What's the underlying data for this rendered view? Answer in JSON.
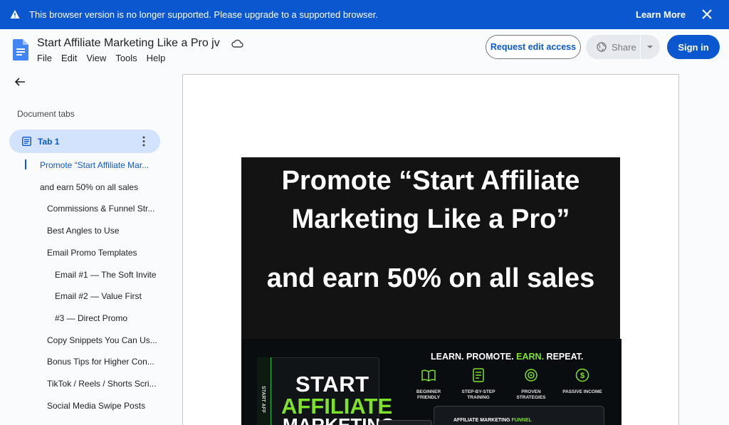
{
  "banner": {
    "message": "This browser version is no longer supported. Please upgrade to a supported browser.",
    "learn_more": "Learn More",
    "icons": {
      "warning": "warning-icon",
      "close": "close-icon"
    }
  },
  "header": {
    "title": "Start Affiliate Marketing Like a Pro jv",
    "menu": [
      "File",
      "Edit",
      "View",
      "Tools",
      "Help"
    ],
    "request_access": "Request edit access",
    "share": "Share",
    "sign_in": "Sign in",
    "accent_color": "#0b57d0"
  },
  "sidebar": {
    "section_label": "Document tabs",
    "tab": {
      "label": "Tab 1"
    },
    "outline": [
      {
        "label": "Promote “Start Affiliate Mar...",
        "level": 1,
        "active": true
      },
      {
        "label": "and earn 50% on all sales",
        "level": 1,
        "active": false
      },
      {
        "label": "Commissions & Funnel Str...",
        "level": 2,
        "active": false
      },
      {
        "label": "Best Angles to Use",
        "level": 2,
        "active": false
      },
      {
        "label": "Email Promo Templates",
        "level": 2,
        "active": false
      },
      {
        "label": "Email #1 — The Soft Invite",
        "level": 3,
        "active": false
      },
      {
        "label": "Email #2 — Value First",
        "level": 3,
        "active": false
      },
      {
        "label": "#3 — Direct Promo",
        "level": 3,
        "active": false
      },
      {
        "label": "Copy Snippets You Can Us...",
        "level": 2,
        "active": false
      },
      {
        "label": "Bonus Tips for Higher Con...",
        "level": 2,
        "active": false
      },
      {
        "label": "TikTok / Reels / Shorts Scri...",
        "level": 2,
        "active": false
      },
      {
        "label": "Social Media Swipe Posts",
        "level": 2,
        "active": false
      }
    ]
  },
  "document": {
    "heading_line1": "Promote “Start Affiliate",
    "heading_line2": "Marketing Like a Pro”",
    "subheading": "and earn 50% on all sales",
    "promo": {
      "tagline_learn": "LEARN. PROMOTE. ",
      "tagline_earn": "EARN.",
      "tagline_repeat": " REPEAT.",
      "features": [
        "BEGINNER FRIENDLY",
        "STEP-BY-STEP TRAINING",
        "PROVEN STRATEGIES",
        "PASSIVE INCOME"
      ],
      "box_start": "START",
      "box_affiliate": "AFFILIATE",
      "box_marketing": "MARKETING",
      "spine": "START AFF",
      "funnel_prefix": "AFFILIATE MARKETING ",
      "funnel_word": "FUNNEL"
    }
  }
}
